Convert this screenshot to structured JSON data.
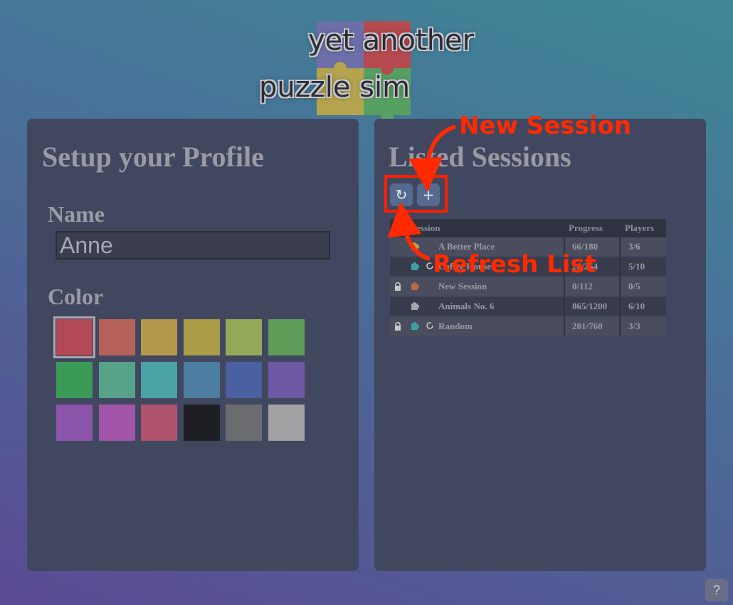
{
  "logo": {
    "line1": "yet another",
    "line2": "puzzle sim"
  },
  "profile": {
    "title": "Setup your Profile",
    "name_label": "Name",
    "name_value": "Anne",
    "color_label": "Color",
    "selected_color_index": 0,
    "colors": [
      "#b24a56",
      "#b5625a",
      "#b5974e",
      "#a99d48",
      "#94aa58",
      "#5e9c58",
      "#3c9a58",
      "#56a38a",
      "#4ba2a4",
      "#4d7ea2",
      "#4a60a0",
      "#6e58a4",
      "#8a55a8",
      "#a055a8",
      "#b0536e",
      "#1e1f24",
      "#6b6c6f",
      "#a2a2a4"
    ]
  },
  "sessions": {
    "title": "Listed Sessions",
    "refresh_icon": "refresh-icon",
    "new_icon": "plus-icon",
    "refresh_glyph": "↻",
    "new_glyph": "+",
    "columns": [
      "Session",
      "Progress",
      "Players"
    ],
    "rows": [
      {
        "locked": false,
        "puzzle_color": "#b8a449",
        "has_refresh": false,
        "name": "A Better Place",
        "progress": "66/180",
        "players": "3/6"
      },
      {
        "locked": false,
        "puzzle_color": "#3f9fa6",
        "has_refresh": true,
        "name": "Coffee House",
        "progress": "26/254",
        "players": "5/10"
      },
      {
        "locked": true,
        "puzzle_color": "#b56a4c",
        "has_refresh": false,
        "name": "New Session",
        "progress": "0/112",
        "players": "0/5"
      },
      {
        "locked": false,
        "puzzle_color": "#a6a6ac",
        "has_refresh": false,
        "name": "Animals No. 6",
        "progress": "865/1200",
        "players": "6/10"
      },
      {
        "locked": true,
        "puzzle_color": "#3f9fa6",
        "has_refresh": true,
        "name": "Random",
        "progress": "201/760",
        "players": "3/3"
      }
    ]
  },
  "annotations": {
    "new_session": "New Session",
    "refresh_list": "Refresh List"
  },
  "help": {
    "label": "?"
  }
}
